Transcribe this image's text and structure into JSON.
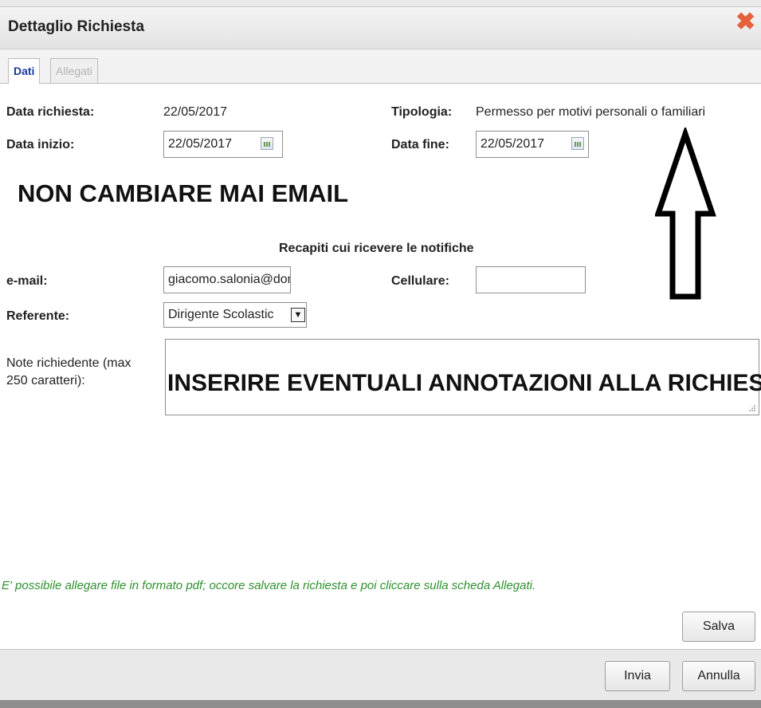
{
  "dialog": {
    "title": "Dettaglio Richiesta",
    "close_glyph": "✖"
  },
  "tabs": [
    {
      "label": "Dati",
      "active": true
    },
    {
      "label": "Allegati",
      "active": false
    }
  ],
  "form": {
    "data_richiesta_label": "Data richiesta:",
    "data_richiesta_value": "22/05/2017",
    "tipologia_label": "Tipologia:",
    "tipologia_value": "Permesso per motivi personali o familiari",
    "data_inizio_label": "Data inizio:",
    "data_inizio_value": "22/05/2017",
    "data_fine_label": "Data fine:",
    "data_fine_value": "22/05/2017",
    "recapiti_heading": "Recapiti cui ricevere le notifiche",
    "email_label": "e-mail:",
    "email_value": "giacomo.salonia@donmilanita",
    "cellulare_label": "Cellulare:",
    "cellulare_value": "",
    "referente_label": "Referente:",
    "referente_value": "Dirigente Scolastic",
    "note_label": "Note richiedente (max 250 caratteri):"
  },
  "annotations": {
    "email_warning": "NON CAMBIARE MAI EMAIL",
    "note_instruction": "INSERIRE EVENTUALI ANNOTAZIONI ALLA RICHIESTA"
  },
  "hint_text": "E' possibile allegare file in formato pdf; occore salvare la richiesta e poi cliccare sulla scheda Allegati.",
  "buttons": {
    "salva": "Salva",
    "invia": "Invia",
    "annulla": "Annulla"
  },
  "icons": [
    "close-icon",
    "calendar-icon",
    "dropdown-arrow-icon",
    "resize-grip-icon",
    "up-arrow-icon"
  ],
  "colors": {
    "close": "#e5603b",
    "active_tab": "#1a3aa0",
    "hint": "#2f8f2f"
  }
}
